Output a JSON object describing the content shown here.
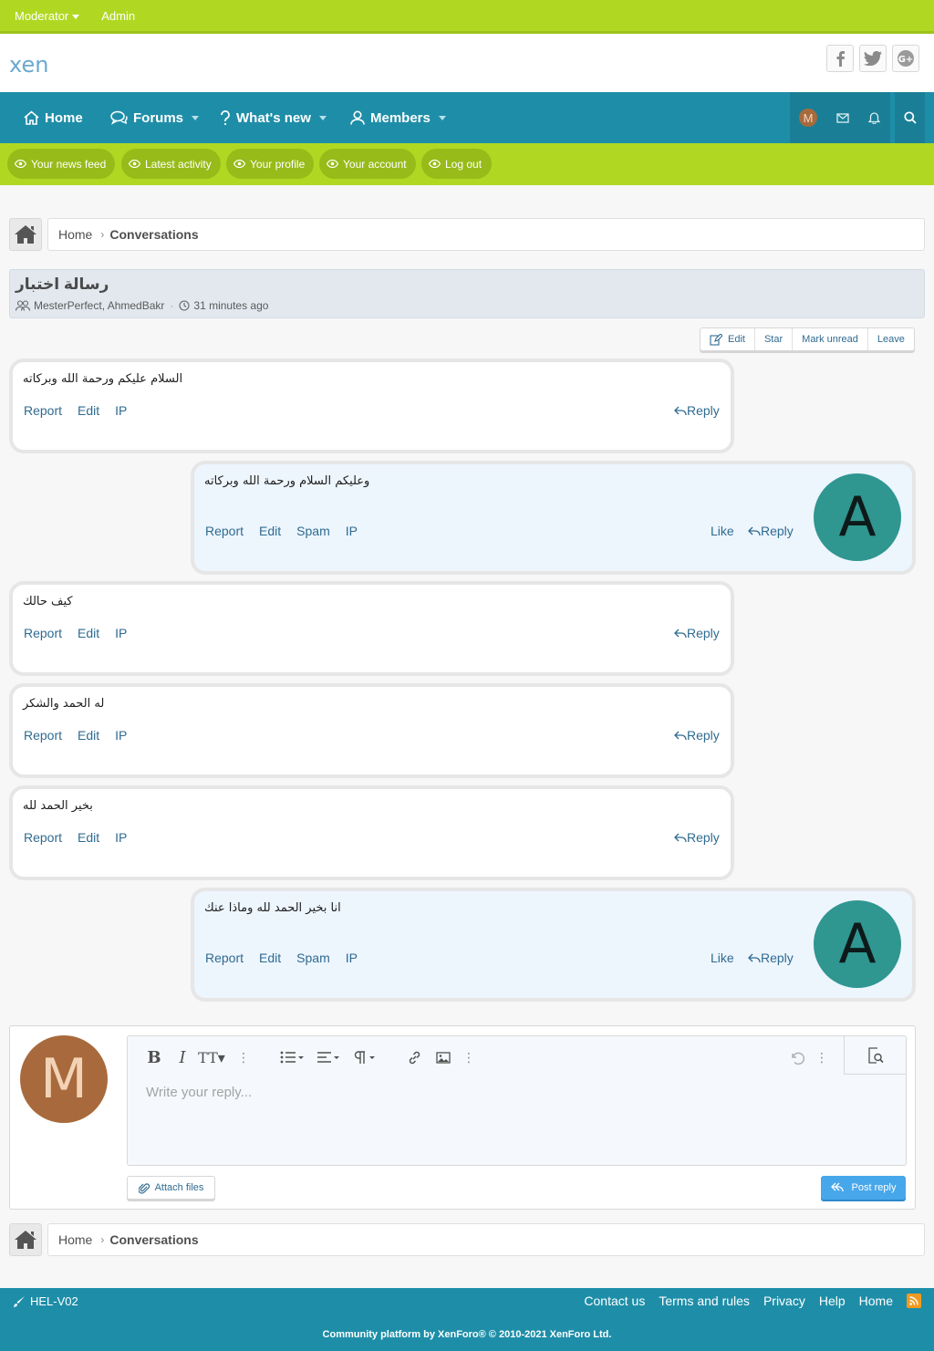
{
  "staffbar": {
    "moderator": "Moderator",
    "admin": "Admin"
  },
  "header": {
    "logo": "xen"
  },
  "nav": {
    "home": "Home",
    "forums": "Forums",
    "whats_new": "What's new",
    "members": "Members",
    "user_initial": "M"
  },
  "subnav": [
    "Your news feed",
    "Latest activity",
    "Your profile",
    "Your account",
    "Log out"
  ],
  "breadcrumb": {
    "home": "Home",
    "current": "Conversations"
  },
  "conversation": {
    "title": "رسالة اختبار",
    "participants": "MesterPerfect, AhmedBakr",
    "sep": "·",
    "time": "31 minutes ago"
  },
  "actions": {
    "edit": "Edit",
    "star": "Star",
    "mark_unread": "Mark unread",
    "leave": "Leave"
  },
  "labels": {
    "report": "Report",
    "edit": "Edit",
    "spam": "Spam",
    "ip": "IP",
    "like": "Like",
    "reply": "Reply"
  },
  "messages": [
    {
      "text": "السلام عليكم ورحمة الله وبركاته"
    },
    {
      "text": "وعليكم السلام ورحمة الله وبركاته",
      "avatar": "A"
    },
    {
      "text": "كيف حالك"
    },
    {
      "text": "له الحمد والشكر"
    },
    {
      "text": "بخير الحمد لله"
    },
    {
      "text": "انا بخير الحمد لله وماذا عنك",
      "avatar": "A"
    }
  ],
  "reply": {
    "avatar": "M",
    "placeholder": "Write your reply...",
    "attach": "Attach files",
    "post": "Post reply"
  },
  "footer": {
    "style": "HEL-V02",
    "links": [
      "Contact us",
      "Terms and rules",
      "Privacy",
      "Help",
      "Home"
    ],
    "copyright": "Community platform by XenForo® © 2010-2021 XenForo Ltd."
  },
  "colors": {
    "primary": "#1e8ea8",
    "accent": "#b0d822",
    "link": "#2f6b91",
    "avatar_a": "#2f9690",
    "avatar_m": "#a86a3c"
  }
}
